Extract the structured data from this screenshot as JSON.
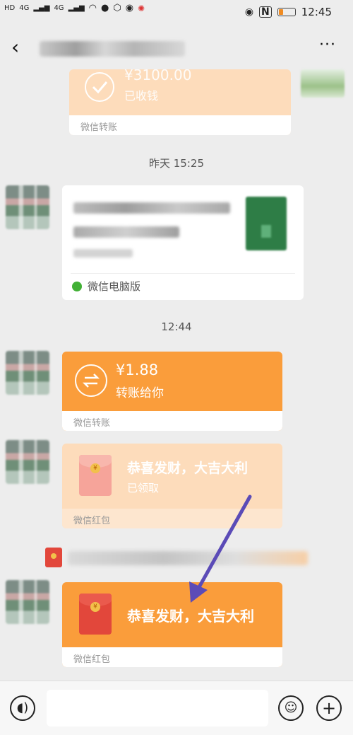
{
  "status_bar": {
    "left_icons": [
      "hd-icon",
      "signal-4g-icon",
      "signal-4g-icon",
      "wifi-icon",
      "qq-icon",
      "app-icon",
      "app-icon",
      "app-icon"
    ],
    "network_labels": [
      "HD",
      "4G",
      "4G"
    ],
    "right_icons": [
      "eye-icon",
      "nfc-icon",
      "battery-icon"
    ],
    "battery_level": 0.25,
    "time": "12:45"
  },
  "header": {
    "back_label": "‹",
    "more_label": "···"
  },
  "messages": {
    "transfer_received": {
      "amount": "¥3100.00",
      "status": "已收钱",
      "source": "微信转账"
    },
    "timestamp_1": "昨天 15:25",
    "file_message": {
      "source": "微信电脑版"
    },
    "timestamp_2": "12:44",
    "transfer_sent": {
      "amount": "¥1.88",
      "status": "转账给你",
      "source": "微信转账"
    },
    "red_packet_opened": {
      "greeting": "恭喜发财，大吉大利",
      "status": "已领取",
      "source": "微信红包"
    },
    "red_packet_new": {
      "greeting": "恭喜发财，大吉大利",
      "source": "微信红包"
    }
  },
  "colors": {
    "orange": "#fa9d3b",
    "pale_orange": "#fddcbb",
    "arrow": "#5b4bb7",
    "red_envelope": "#e2473b"
  }
}
